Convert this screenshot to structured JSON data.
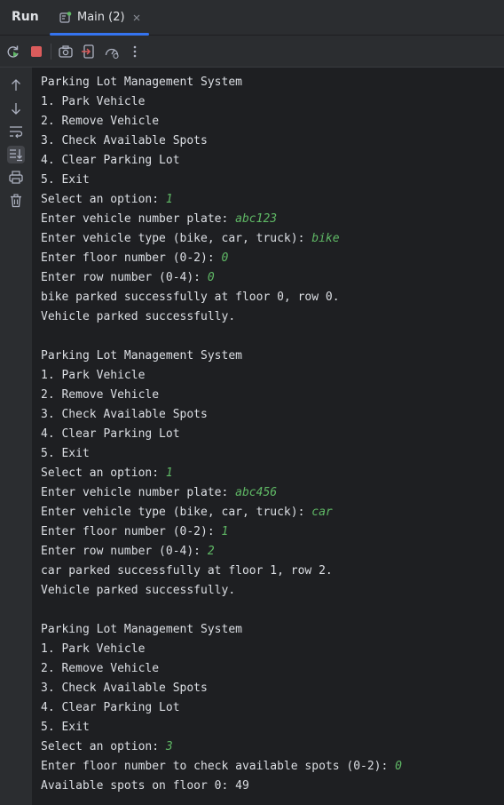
{
  "tool_window": {
    "title": "Run",
    "tab": {
      "label": "Main (2)"
    }
  },
  "toolbar": {
    "buttons": [
      "rerun-icon",
      "stop-icon",
      "camera-icon",
      "exit-icon",
      "dashboard-icon",
      "more-icon"
    ]
  },
  "sidebar": {
    "buttons": [
      "arrow-up-icon",
      "arrow-down-icon",
      "soft-wrap-icon",
      "scroll-to-end-icon",
      "print-icon",
      "trash-icon"
    ]
  },
  "colors": {
    "background": "#1e1f22",
    "panel": "#2b2d30",
    "text": "#dcdfe4",
    "user_input": "#5fb865",
    "accent": "#3574f0",
    "stop": "#db5c5c"
  },
  "console": {
    "lines": [
      {
        "text": "Parking Lot Management System",
        "input": ""
      },
      {
        "text": "1. Park Vehicle",
        "input": ""
      },
      {
        "text": "2. Remove Vehicle",
        "input": ""
      },
      {
        "text": "3. Check Available Spots",
        "input": ""
      },
      {
        "text": "4. Clear Parking Lot",
        "input": ""
      },
      {
        "text": "5. Exit",
        "input": ""
      },
      {
        "text": "Select an option: ",
        "input": "1"
      },
      {
        "text": "Enter vehicle number plate: ",
        "input": "abc123"
      },
      {
        "text": "Enter vehicle type (bike, car, truck): ",
        "input": "bike"
      },
      {
        "text": "Enter floor number (0-2): ",
        "input": "0"
      },
      {
        "text": "Enter row number (0-4): ",
        "input": "0"
      },
      {
        "text": "bike parked successfully at floor 0, row 0.",
        "input": ""
      },
      {
        "text": "Vehicle parked successfully.",
        "input": ""
      },
      {
        "text": "",
        "input": ""
      },
      {
        "text": "Parking Lot Management System",
        "input": ""
      },
      {
        "text": "1. Park Vehicle",
        "input": ""
      },
      {
        "text": "2. Remove Vehicle",
        "input": ""
      },
      {
        "text": "3. Check Available Spots",
        "input": ""
      },
      {
        "text": "4. Clear Parking Lot",
        "input": ""
      },
      {
        "text": "5. Exit",
        "input": ""
      },
      {
        "text": "Select an option: ",
        "input": "1"
      },
      {
        "text": "Enter vehicle number plate: ",
        "input": "abc456"
      },
      {
        "text": "Enter vehicle type (bike, car, truck): ",
        "input": "car"
      },
      {
        "text": "Enter floor number (0-2): ",
        "input": "1"
      },
      {
        "text": "Enter row number (0-4): ",
        "input": "2"
      },
      {
        "text": "car parked successfully at floor 1, row 2.",
        "input": ""
      },
      {
        "text": "Vehicle parked successfully.",
        "input": ""
      },
      {
        "text": "",
        "input": ""
      },
      {
        "text": "Parking Lot Management System",
        "input": ""
      },
      {
        "text": "1. Park Vehicle",
        "input": ""
      },
      {
        "text": "2. Remove Vehicle",
        "input": ""
      },
      {
        "text": "3. Check Available Spots",
        "input": ""
      },
      {
        "text": "4. Clear Parking Lot",
        "input": ""
      },
      {
        "text": "5. Exit",
        "input": ""
      },
      {
        "text": "Select an option: ",
        "input": "3"
      },
      {
        "text": "Enter floor number to check available spots (0-2): ",
        "input": "0"
      },
      {
        "text": "Available spots on floor 0: 49",
        "input": ""
      }
    ]
  }
}
